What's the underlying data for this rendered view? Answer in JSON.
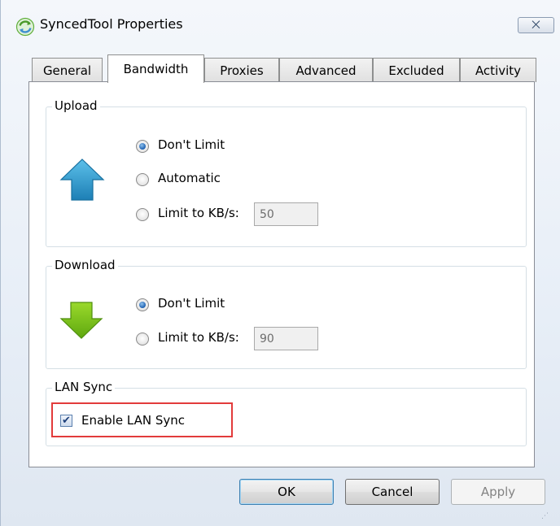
{
  "window": {
    "title": "SyncedTool Properties",
    "close_glyph": "⨉"
  },
  "tabs": [
    {
      "label": "General",
      "active": false
    },
    {
      "label": "Bandwidth",
      "active": true
    },
    {
      "label": "Proxies",
      "active": false
    },
    {
      "label": "Advanced",
      "active": false
    },
    {
      "label": "Excluded",
      "active": false
    },
    {
      "label": "Activity",
      "active": false
    }
  ],
  "upload": {
    "label": "Upload",
    "icon": "upload-arrow-icon",
    "options": [
      {
        "label": "Don't Limit",
        "checked": true
      },
      {
        "label": "Automatic",
        "checked": false
      },
      {
        "label": "Limit to KB/s:",
        "checked": false
      }
    ],
    "limit_value": "50"
  },
  "download": {
    "label": "Download",
    "icon": "download-arrow-icon",
    "options": [
      {
        "label": "Don't Limit",
        "checked": true
      },
      {
        "label": "Limit to KB/s:",
        "checked": false
      }
    ],
    "limit_value": "90"
  },
  "lan_sync": {
    "label": "LAN Sync",
    "checkbox_label": "Enable LAN Sync",
    "checked": true,
    "check_glyph": "✔"
  },
  "buttons": {
    "ok": "OK",
    "cancel": "Cancel",
    "apply": "Apply"
  },
  "colors": {
    "highlight": "#e23b3b",
    "upload_arrow": "#2e95c8",
    "download_arrow": "#7ac21a"
  }
}
